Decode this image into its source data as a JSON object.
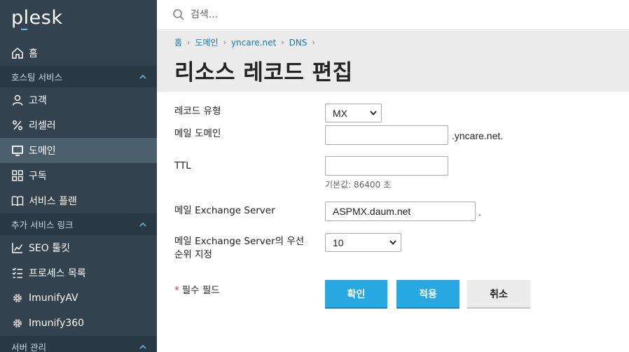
{
  "brand": {
    "logo_text": "plesk"
  },
  "search": {
    "placeholder": "검색..."
  },
  "sidebar": {
    "home": "홈",
    "sections": [
      {
        "title": "호스팅 서비스"
      },
      {
        "title": "추가 서비스 링크"
      },
      {
        "title": "서버 관리"
      }
    ],
    "hosting_items": [
      {
        "label": "고객",
        "icon": "user-icon"
      },
      {
        "label": "리셀러",
        "icon": "percent-icon"
      },
      {
        "label": "도메인",
        "icon": "monitor-icon",
        "active": true
      },
      {
        "label": "구독",
        "icon": "grid-icon"
      },
      {
        "label": "서비스 플랜",
        "icon": "book-icon"
      }
    ],
    "extra_items": [
      {
        "label": "SEO 툴킷",
        "icon": "chart-icon"
      },
      {
        "label": "프로세스 목록",
        "icon": "list-icon"
      },
      {
        "label": "ImunifyAV",
        "icon": "gear-icon"
      },
      {
        "label": "Imunify360",
        "icon": "gear-icon"
      }
    ]
  },
  "breadcrumb": [
    "홈",
    "도메인",
    "yncare.net",
    "DNS"
  ],
  "page": {
    "title": "리소스 레코드 편집"
  },
  "form": {
    "record_type": {
      "label": "레코드 유형",
      "value": "MX"
    },
    "mail_domain": {
      "label": "메일 도메인",
      "value": "",
      "suffix": ".yncare.net."
    },
    "ttl": {
      "label": "TTL",
      "value": "",
      "hint": "기본값: 86400 초"
    },
    "exchange_server": {
      "label": "메일 Exchange Server",
      "value": "ASPMX.daum.net",
      "suffix": "."
    },
    "priority": {
      "label_line1": "메일 Exchange Server의 우선",
      "label_line2": "순위 지정",
      "value": "10"
    },
    "required_star": "*",
    "required_note": "필수 필드",
    "buttons": {
      "ok": "확인",
      "apply": "적용",
      "cancel": "취소"
    }
  },
  "colors": {
    "sidebar_bg": "#32434f",
    "accent": "#28a8e0",
    "link": "#1c77a9"
  }
}
